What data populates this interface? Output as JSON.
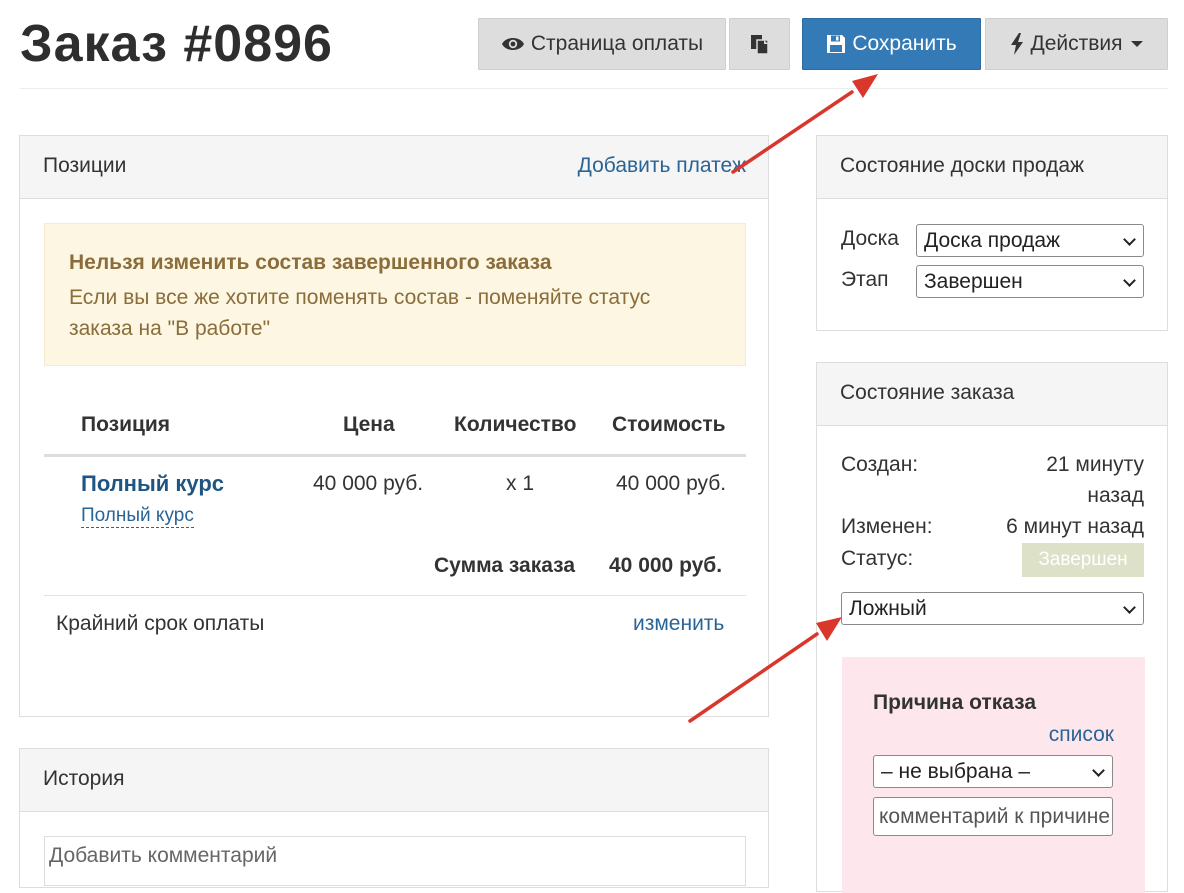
{
  "header": {
    "title": "Заказ #0896",
    "payment_page_label": "Страница оплаты",
    "save_label": "Сохранить",
    "actions_label": "Действия"
  },
  "positions_panel": {
    "title": "Позиции",
    "add_payment_link": "Добавить платеж",
    "warning_title": "Нельзя изменить состав завершенного заказа",
    "warning_text": "Если вы все же хотите поменять состав - поменяйте статус заказа на \"В работе\"",
    "table": {
      "headers": [
        "Позиция",
        "Цена",
        "Количество",
        "Стоимость"
      ],
      "rows": [
        {
          "name": "Полный курс",
          "subname": "Полный курс",
          "price": "40 000 руб.",
          "qty": "х 1",
          "cost": "40 000 руб."
        }
      ],
      "total_label": "Сумма заказа",
      "total_value": "40 000 руб."
    },
    "deadline_label": "Крайний срок оплаты",
    "deadline_change_link": "изменить"
  },
  "history_panel": {
    "title": "История",
    "comment_placeholder": "Добавить комментарий"
  },
  "board_panel": {
    "title": "Состояние доски продаж",
    "board_label": "Доска",
    "board_value": "Доска продаж",
    "stage_label": "Этап",
    "stage_value": "Завершен"
  },
  "order_state_panel": {
    "title": "Состояние заказа",
    "created_label": "Создан:",
    "created_value_line1": "21 минуту",
    "created_value_line2": "назад",
    "modified_label": "Изменен:",
    "modified_value": "6 минут назад",
    "status_label": "Статус:",
    "status_value": "Завершен",
    "status_select_value": "Ложный",
    "reject": {
      "title": "Причина отказа",
      "list_link": "список",
      "select_value": "– не выбрана –",
      "comment_placeholder": "комментарий к причине"
    }
  },
  "colors": {
    "primary": "#337ab7",
    "link": "#2a6496",
    "warning_bg": "#fcf6e2",
    "warning_text": "#8a6d3b",
    "reject_bg": "#fde6ec",
    "status_badge_bg": "#dde1c8",
    "arrow": "#d9372b"
  },
  "icons": [
    "eye-icon",
    "copy-icon",
    "floppy-disk-icon",
    "lightning-icon",
    "caret-down-icon",
    "chevron-down-icon",
    "arrow-annotation"
  ]
}
